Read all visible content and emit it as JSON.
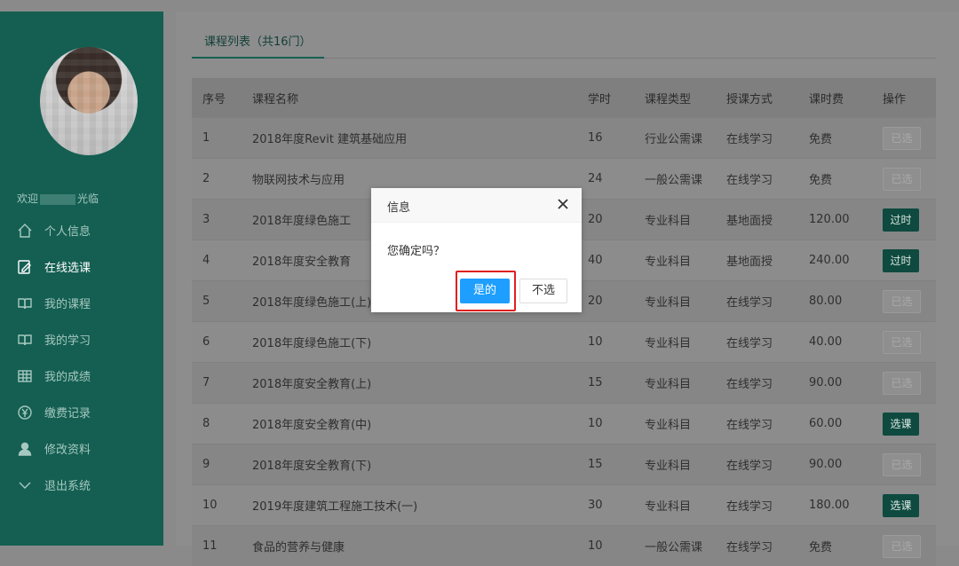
{
  "sidebar": {
    "welcome_prefix": "欢迎",
    "welcome_suffix": "光临",
    "items": [
      {
        "label": "个人信息",
        "icon": "home-icon"
      },
      {
        "label": "在线选课",
        "icon": "edit-note-icon"
      },
      {
        "label": "我的课程",
        "icon": "book-open-icon"
      },
      {
        "label": "我的学习",
        "icon": "book-open-icon"
      },
      {
        "label": "我的成绩",
        "icon": "grid-icon"
      },
      {
        "label": "缴费记录",
        "icon": "yen-circle-icon"
      },
      {
        "label": "修改资料",
        "icon": "user-icon"
      },
      {
        "label": "退出系统",
        "icon": "chevron-down-icon"
      }
    ],
    "active_index": 1
  },
  "tab": {
    "label": "课程列表（共16门）"
  },
  "table": {
    "headers": [
      "序号",
      "课程名称",
      "学时",
      "课程类型",
      "授课方式",
      "课时费",
      "操作"
    ],
    "rows": [
      {
        "no": "1",
        "name": "2018年度Revit 建筑基础应用",
        "hours": "16",
        "type": "行业公需课",
        "mode": "在线学习",
        "fee": "免费",
        "action": "已选",
        "action_kind": "done"
      },
      {
        "no": "2",
        "name": "物联网技术与应用",
        "hours": "24",
        "type": "一般公需课",
        "mode": "在线学习",
        "fee": "免费",
        "action": "已选",
        "action_kind": "done"
      },
      {
        "no": "3",
        "name": "2018年度绿色施工",
        "hours": "20",
        "type": "专业科目",
        "mode": "基地面授",
        "fee": "120.00",
        "action": "过时",
        "action_kind": "over"
      },
      {
        "no": "4",
        "name": "2018年度安全教育",
        "hours": "40",
        "type": "专业科目",
        "mode": "基地面授",
        "fee": "240.00",
        "action": "过时",
        "action_kind": "over"
      },
      {
        "no": "5",
        "name": "2018年度绿色施工(上)",
        "hours": "20",
        "type": "专业科目",
        "mode": "在线学习",
        "fee": "80.00",
        "action": "已选",
        "action_kind": "done"
      },
      {
        "no": "6",
        "name": "2018年度绿色施工(下)",
        "hours": "10",
        "type": "专业科目",
        "mode": "在线学习",
        "fee": "40.00",
        "action": "已选",
        "action_kind": "done"
      },
      {
        "no": "7",
        "name": "2018年度安全教育(上)",
        "hours": "15",
        "type": "专业科目",
        "mode": "在线学习",
        "fee": "90.00",
        "action": "已选",
        "action_kind": "done"
      },
      {
        "no": "8",
        "name": "2018年度安全教育(中)",
        "hours": "10",
        "type": "专业科目",
        "mode": "在线学习",
        "fee": "60.00",
        "action": "选课",
        "action_kind": "choose"
      },
      {
        "no": "9",
        "name": "2018年度安全教育(下)",
        "hours": "15",
        "type": "专业科目",
        "mode": "在线学习",
        "fee": "90.00",
        "action": "已选",
        "action_kind": "done"
      },
      {
        "no": "10",
        "name": "2019年度建筑工程施工技术(一)",
        "hours": "30",
        "type": "专业科目",
        "mode": "在线学习",
        "fee": "180.00",
        "action": "选课",
        "action_kind": "choose"
      },
      {
        "no": "11",
        "name": "食品的营养与健康",
        "hours": "10",
        "type": "一般公需课",
        "mode": "在线学习",
        "fee": "免费",
        "action": "已选",
        "action_kind": "done"
      }
    ]
  },
  "dialog": {
    "title": "信息",
    "message": "您确定吗？",
    "confirm_label": "是的",
    "cancel_label": "不选"
  },
  "colors": {
    "sidebar": "#145f52",
    "primary_button": "#1e9fff",
    "highlight_border": "#e02020"
  }
}
